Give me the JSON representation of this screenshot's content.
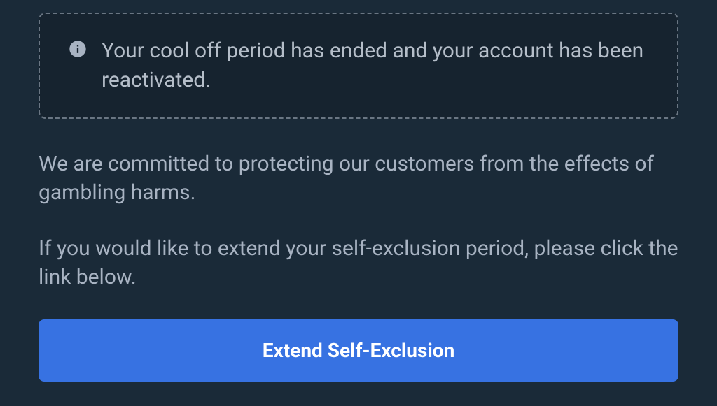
{
  "notice": {
    "message": "Your cool off period has ended and your account has been reactivated."
  },
  "body": {
    "paragraph1": "We are committed to protecting our customers from the effects of gambling harms.",
    "paragraph2": "If you would like to extend your self-exclusion period, please click the link below."
  },
  "actions": {
    "extend_label": "Extend Self-Exclusion"
  }
}
